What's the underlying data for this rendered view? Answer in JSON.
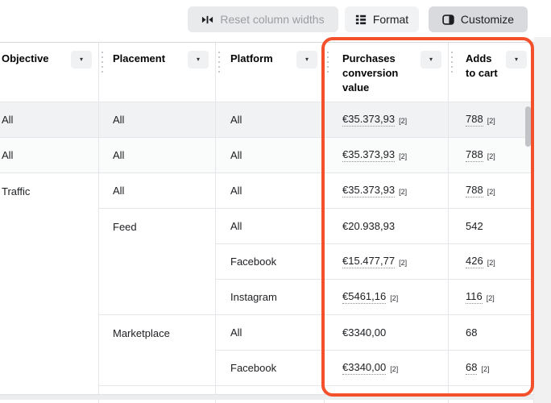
{
  "toolbar": {
    "reset_label": "Reset column widths",
    "format_label": "Format",
    "customize_label": "Customize"
  },
  "icons": {
    "dropdown_chevron": "▾"
  },
  "header": {
    "objective": "Objective",
    "placement": "Placement",
    "platform": "Platform",
    "purchases": "Purchases conversion value",
    "adds": "Adds to cart"
  },
  "rows": [
    {
      "objective": "All",
      "placement": "All",
      "platform": "All",
      "purchases": "€35.373,93",
      "purchases_note": "[2]",
      "adds": "788",
      "adds_note": "[2]"
    },
    {
      "objective": "All",
      "placement": "All",
      "platform": "All",
      "purchases": "€35.373,93",
      "purchases_note": "[2]",
      "adds": "788",
      "adds_note": "[2]"
    },
    {
      "objective": "Traffic",
      "placement": "All",
      "platform": "All",
      "purchases": "€35.373,93",
      "purchases_note": "[2]",
      "adds": "788",
      "adds_note": "[2]"
    },
    {
      "placement": "Feed",
      "platform": "All",
      "purchases": "€20.938,93",
      "adds": "542"
    },
    {
      "platform": "Facebook",
      "purchases": "€15.477,77",
      "purchases_note": "[2]",
      "adds": "426",
      "adds_note": "[2]"
    },
    {
      "platform": "Instagram",
      "purchases": "€5461,16",
      "purchases_note": "[2]",
      "adds": "116",
      "adds_note": "[2]"
    },
    {
      "placement": "Marketplace",
      "platform": "All",
      "purchases": "€3340,00",
      "adds": "68"
    },
    {
      "platform": "Facebook",
      "purchases": "€3340,00",
      "purchases_note": "[2]",
      "adds": "68",
      "adds_note": "[2]"
    }
  ],
  "colors": {
    "highlight_border": "#f3502b",
    "selected_row_bg": "#f1f2f4",
    "customize_button_bg": "#d8dade"
  }
}
